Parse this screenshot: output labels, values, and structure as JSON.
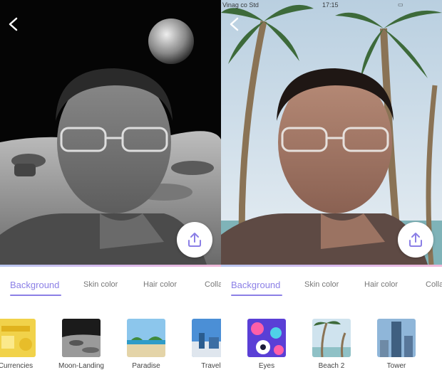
{
  "left": {
    "tabs": [
      "Background",
      "Skin color",
      "Hair color",
      "Colla"
    ],
    "thumbs": [
      "Currencies",
      "Moon-Landing",
      "Paradise",
      "Travel"
    ]
  },
  "right": {
    "status": {
      "carrier": "Vinag co Std",
      "time": "17:15"
    },
    "tabs": [
      "Background",
      "Skin color",
      "Hair color",
      "Colla"
    ],
    "thumbs": [
      "Eyes",
      "Beach 2",
      "Tower"
    ]
  },
  "icons": {
    "back": "chevron-left-icon",
    "share": "upload-icon"
  },
  "colors": {
    "accent": "#8b7fe6",
    "divider_gradient": [
      "#b9c7f0",
      "#d8b9ef",
      "#f0b9d9"
    ]
  }
}
